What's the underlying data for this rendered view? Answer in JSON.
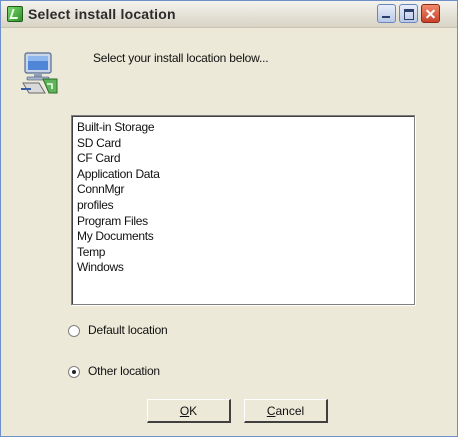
{
  "window": {
    "title": "Select install location",
    "title_icon": "app-check-icon",
    "controls": [
      "minimize",
      "maximize",
      "close"
    ]
  },
  "instruction": "Select your install location below...",
  "header_icon": "computer-install-icon",
  "locations": [
    "Built-in Storage",
    "SD Card",
    "CF Card",
    "Application Data",
    "ConnMgr",
    "profiles",
    "Program Files",
    "My Documents",
    "Temp",
    "Windows"
  ],
  "radios": {
    "default": {
      "label": "Default location",
      "checked": false
    },
    "other": {
      "label": "Other location",
      "checked": true
    }
  },
  "buttons": {
    "ok": {
      "mnemonic": "O",
      "rest": "K"
    },
    "cancel": {
      "mnemonic": "C",
      "rest": "ancel"
    }
  },
  "colors": {
    "dialog_background": "#ece9d8",
    "close_button": "#c8412a",
    "title_bar": "#e4e1d6"
  }
}
